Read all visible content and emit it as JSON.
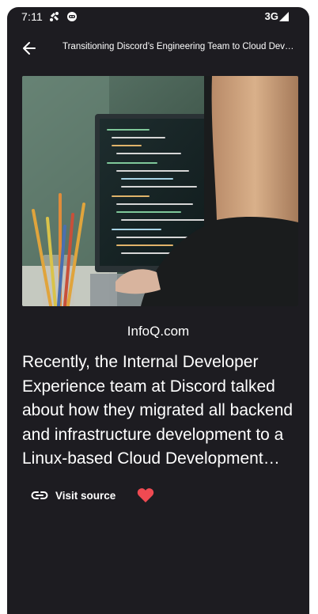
{
  "status_bar": {
    "time": "7:11",
    "network": "3G",
    "icons": [
      "notification-icon",
      "app-notification-icon",
      "signal-icon"
    ]
  },
  "app_bar": {
    "back_icon": "arrow-back-icon",
    "title": "Transitioning Discord’s Engineering Team to Cloud Development Environments"
  },
  "article": {
    "image": "photo of a person viewing code on a monitor",
    "source": "InfoQ.com",
    "description": "Recently, the Internal Developer Experience team at Discord talked about how they migrated all backend and infrastructure development to a Linux-based Cloud Development Environment",
    "visit_source_label": "Visit source",
    "visit_icon": "link-icon",
    "favorite_icon": "heart-icon"
  },
  "colors": {
    "background": "#1d1c21",
    "text": "#ffffff",
    "heart": "#ef4a52"
  }
}
